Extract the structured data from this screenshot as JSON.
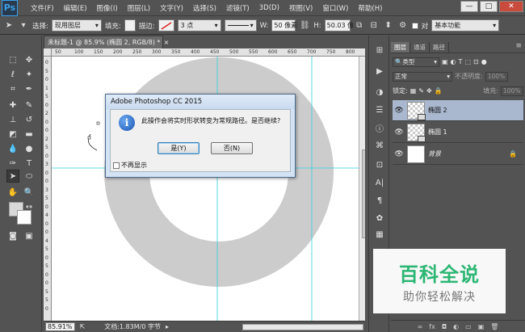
{
  "app": {
    "logo": "Ps"
  },
  "menu": [
    "文件(F)",
    "编辑(E)",
    "图像(I)",
    "图层(L)",
    "文字(Y)",
    "选择(S)",
    "滤镜(T)",
    "3D(D)",
    "视图(V)",
    "窗口(W)",
    "帮助(H)"
  ],
  "window_buttons": {
    "minimize": "—",
    "restore": "□",
    "close": "✕"
  },
  "options": {
    "select_label": "选择:",
    "select_value": "现用图层",
    "fill_label": "填充:",
    "stroke_label": "描边:",
    "stroke_size": "3 点",
    "w_label": "W:",
    "w_value": "50 像素",
    "h_label": "H:",
    "h_value": "50.03 像",
    "workspace_value": "基本功能",
    "workspace_check_label": "对"
  },
  "document": {
    "tab_title": "未标题-1 @ 85.9% (椭圆 2, RGB/8) *",
    "tab_close": "×",
    "ruler_top": [
      "50",
      "100",
      "150",
      "200",
      "250",
      "300",
      "350",
      "400",
      "450",
      "500",
      "550",
      "600",
      "650",
      "700",
      "750",
      "800"
    ],
    "ruler_left": [
      "0",
      "5",
      "0",
      "1",
      "5",
      "0",
      "2",
      "0",
      "0",
      "2",
      "5",
      "0",
      "3",
      "0",
      "0",
      "3",
      "5",
      "0",
      "4",
      "0",
      "0",
      "4",
      "5",
      "0",
      "5",
      "0",
      "0",
      "5",
      "5",
      "0"
    ]
  },
  "status": {
    "zoom": "85.91%",
    "doc_info": "文档:1.83M/0 字节"
  },
  "layers_panel": {
    "tabs": [
      "图层",
      "通道",
      "路径"
    ],
    "filter_kind": "类型",
    "blend_mode": "正常",
    "opacity_label": "不透明度:",
    "opacity_value": "100%",
    "lock_label": "锁定:",
    "fill_label": "填充:",
    "fill_value": "100%",
    "layers": [
      {
        "name": "椭圆 2",
        "selected": true
      },
      {
        "name": "椭圆 1",
        "selected": false
      },
      {
        "name": "背景",
        "selected": false
      }
    ],
    "footer_icons": [
      "∞",
      "fx",
      "◘",
      "◐",
      "▭",
      "▣",
      "🗑"
    ]
  },
  "dialog": {
    "title": "Adobe Photoshop CC 2015",
    "icon_glyph": "i",
    "message": "此操作会将实时形状转变为常规路径。是否继续?",
    "yes_label": "是(Y)",
    "no_label": "否(N)",
    "dont_show_label": "不再显示"
  },
  "watermark": {
    "main": "百科全说",
    "sub": "助你轻松解决"
  },
  "colors": {
    "ring": "#cccccc",
    "guide": "#2fd0e0",
    "layer_selected": "#a9b8cf",
    "watermark_green": "#2bb673"
  }
}
